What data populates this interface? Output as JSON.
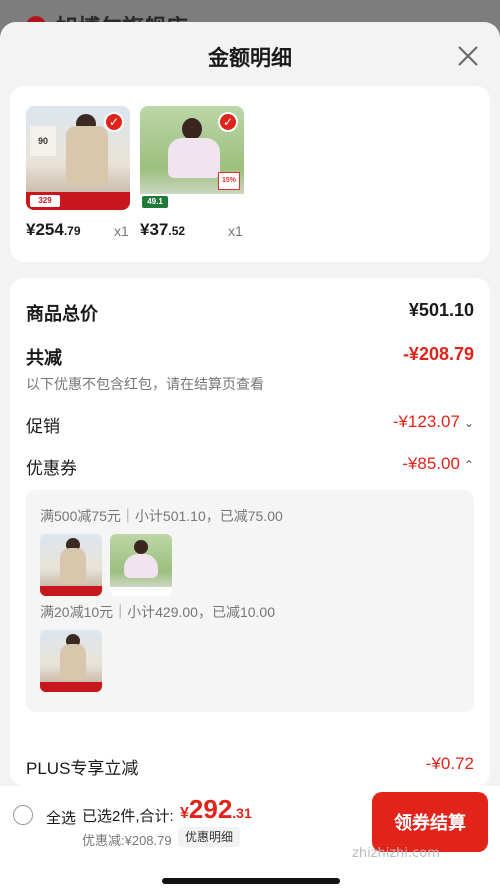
{
  "background": {
    "store_name": "旭博尔旗舰店"
  },
  "sheet": {
    "title": "金额明细"
  },
  "products": [
    {
      "price_int": "¥254",
      "price_dec": ".79",
      "qty": "x1",
      "img_tag": "90",
      "img_bar": "329"
    },
    {
      "price_int": "¥37",
      "price_dec": ".52",
      "qty": "x1",
      "img_tag": "49.1",
      "img_badge": "15%"
    }
  ],
  "summary": {
    "total_label": "商品总价",
    "total_value": "¥501.10",
    "reduced_label": "共减",
    "reduced_value": "-¥208.79",
    "note": "以下优惠不包含红包，请在结算页查看",
    "promo_label": "促销",
    "promo_value": "-¥123.07",
    "coupon_label": "优惠券",
    "coupon_value": "-¥85.00",
    "coupon_lines": [
      "满500减75元｜小计501.10，已减75.00",
      "满20减10元｜小计429.00，已减10.00"
    ],
    "plus_label": "PLUS专享立减",
    "plus_value": "-¥0.72"
  },
  "bottom": {
    "select_all": "全选",
    "selected": "已选2件,合计:",
    "total_cur": "¥",
    "total_int": "292",
    "total_dec": ".31",
    "discount": "优惠减:¥208.79",
    "detail": "优惠明细",
    "checkout": "领券结算",
    "watermark": "zhizhizhi.com"
  },
  "colors": {
    "accent": "#e2231a",
    "sheet_bg": "#f3f3f3"
  }
}
